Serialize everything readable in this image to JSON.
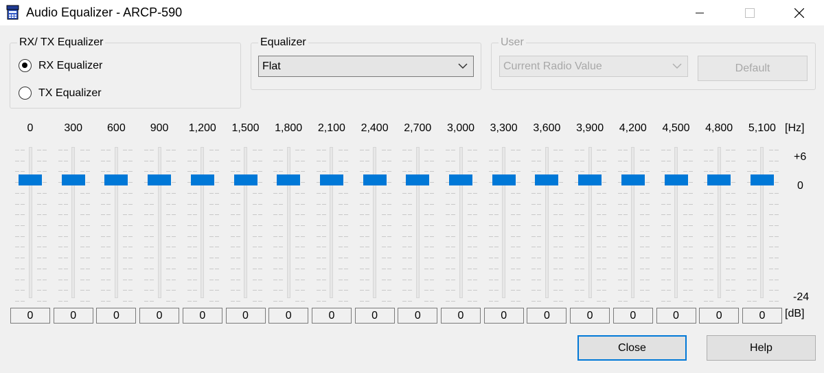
{
  "window": {
    "title": "Audio Equalizer - ARCP-590",
    "icon": "radio-app-icon"
  },
  "rx_tx_group": {
    "label": "RX/ TX Equalizer",
    "options": [
      {
        "label": "RX Equalizer",
        "selected": true
      },
      {
        "label": "TX Equalizer",
        "selected": false
      }
    ]
  },
  "equalizer_group": {
    "label": "Equalizer",
    "selected": "Flat"
  },
  "user_group": {
    "label": "User",
    "selected": "Current Radio Value",
    "default_button": "Default",
    "enabled": false
  },
  "eq": {
    "frequency_unit": "[Hz]",
    "gain_unit": "[dB]",
    "scale_top": "+6",
    "scale_zero": "0",
    "scale_bottom": "-24",
    "bands": [
      {
        "freq": "0",
        "gain": "0"
      },
      {
        "freq": "300",
        "gain": "0"
      },
      {
        "freq": "600",
        "gain": "0"
      },
      {
        "freq": "900",
        "gain": "0"
      },
      {
        "freq": "1,200",
        "gain": "0"
      },
      {
        "freq": "1,500",
        "gain": "0"
      },
      {
        "freq": "1,800",
        "gain": "0"
      },
      {
        "freq": "2,100",
        "gain": "0"
      },
      {
        "freq": "2,400",
        "gain": "0"
      },
      {
        "freq": "2,700",
        "gain": "0"
      },
      {
        "freq": "3,000",
        "gain": "0"
      },
      {
        "freq": "3,300",
        "gain": "0"
      },
      {
        "freq": "3,600",
        "gain": "0"
      },
      {
        "freq": "3,900",
        "gain": "0"
      },
      {
        "freq": "4,200",
        "gain": "0"
      },
      {
        "freq": "4,500",
        "gain": "0"
      },
      {
        "freq": "4,800",
        "gain": "0"
      },
      {
        "freq": "5,100",
        "gain": "0"
      }
    ]
  },
  "footer": {
    "close_button": "Close",
    "help_button": "Help"
  },
  "colors": {
    "accent": "#0078d7",
    "window_bg": "#f0f0f0"
  }
}
